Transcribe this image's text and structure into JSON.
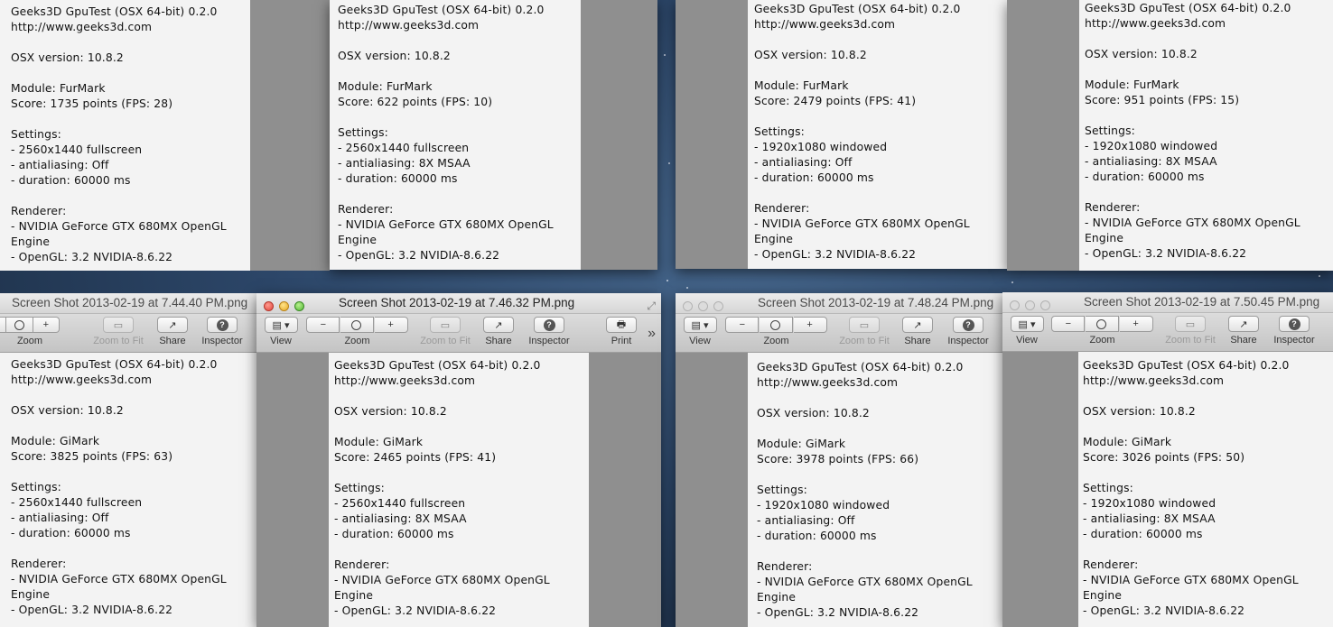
{
  "report_lines": {
    "title": "Geeks3D GpuTest (OSX 64-bit) 0.2.0",
    "url": "http://www.geeks3d.com",
    "osx": "OSX version: 10.8.2",
    "settings": "Settings:",
    "renderer": "Renderer:",
    "renderer_gpu": "- NVIDIA GeForce GTX 680MX OpenGL",
    "renderer_engine": "Engine",
    "opengl": "- OpenGL: 3.2 NVIDIA-8.6.22"
  },
  "toolbar": {
    "view": "View",
    "zoom": "Zoom",
    "zoom_to_fit": "Zoom to Fit",
    "share": "Share",
    "inspector": "Inspector",
    "print": "Print",
    "overflow": "»"
  },
  "windows": [
    {
      "title": "",
      "module": "Module: FurMark",
      "score": "Score: 1735 points (FPS: 28)",
      "resolution": "- 2560x1440 fullscreen",
      "antialiasing": "- antialiasing: Off",
      "duration": "- duration: 60000 ms"
    },
    {
      "title": "",
      "module": "Module: FurMark",
      "score": "Score: 622 points (FPS: 10)",
      "resolution": "- 2560x1440 fullscreen",
      "antialiasing": "- antialiasing: 8X MSAA",
      "duration": "- duration: 60000 ms"
    },
    {
      "title": "",
      "module": "Module: FurMark",
      "score": "Score: 2479 points (FPS: 41)",
      "resolution": "- 1920x1080 windowed",
      "antialiasing": "- antialiasing: Off",
      "duration": "- duration: 60000 ms"
    },
    {
      "title": "",
      "module": "Module: FurMark",
      "score": "Score: 951 points (FPS: 15)",
      "resolution": "- 1920x1080 windowed",
      "antialiasing": "- antialiasing: 8X MSAA",
      "duration": "- duration: 60000 ms"
    },
    {
      "title": "Screen Shot 2013-02-19 at 7.44.40 PM.png",
      "module": "Module: GiMark",
      "score": "Score: 3825 points (FPS: 63)",
      "resolution": "- 2560x1440 fullscreen",
      "antialiasing": "- antialiasing: Off",
      "duration": "- duration: 60000 ms"
    },
    {
      "title": "Screen Shot 2013-02-19 at 7.46.32 PM.png",
      "module": "Module: GiMark",
      "score": "Score: 2465 points (FPS: 41)",
      "resolution": "- 2560x1440 fullscreen",
      "antialiasing": "- antialiasing: 8X MSAA",
      "duration": "- duration: 60000 ms"
    },
    {
      "title": "Screen Shot 2013-02-19 at 7.48.24 PM.png",
      "module": "Module: GiMark",
      "score": "Score: 3978 points (FPS: 66)",
      "resolution": "- 1920x1080 windowed",
      "antialiasing": "- antialiasing: Off",
      "duration": "- duration: 60000 ms"
    },
    {
      "title": "Screen Shot 2013-02-19 at 7.50.45 PM.png",
      "module": "Module: GiMark",
      "score": "Score: 3026 points (FPS: 50)",
      "resolution": "- 1920x1080 windowed",
      "antialiasing": "- antialiasing: 8X MSAA",
      "duration": "- duration: 60000 ms"
    }
  ]
}
